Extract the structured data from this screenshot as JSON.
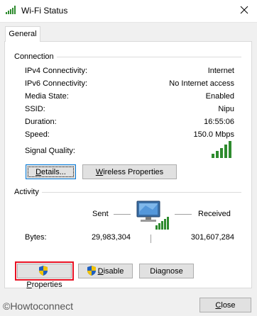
{
  "window": {
    "title": "Wi-Fi Status",
    "icon": "wifi-signal-icon",
    "close_icon": "close-icon"
  },
  "tab": {
    "label": "General"
  },
  "connection": {
    "group_label": "Connection",
    "rows": [
      {
        "label": "IPv4 Connectivity:",
        "value": "Internet"
      },
      {
        "label": "IPv6 Connectivity:",
        "value": "No Internet access"
      },
      {
        "label": "Media State:",
        "value": "Enabled"
      },
      {
        "label": "SSID:",
        "value": "Nipu"
      },
      {
        "label": "Duration:",
        "value": "16:55:06"
      },
      {
        "label": "Speed:",
        "value": "150.0 Mbps"
      }
    ],
    "signal_quality_label": "Signal Quality:",
    "signal_icon": "signal-bars-icon",
    "details_button": {
      "prefix": "",
      "underlined": "D",
      "suffix": "etails..."
    },
    "wireless_button": {
      "prefix": "",
      "underlined": "W",
      "suffix": "ireless Properties"
    }
  },
  "activity": {
    "group_label": "Activity",
    "sent_label": "Sent",
    "received_label": "Received",
    "bytes_label": "Bytes:",
    "bytes_sent": "29,983,304",
    "bytes_received": "301,607,284",
    "icon": "network-computer-icon"
  },
  "buttons": {
    "properties": {
      "prefix": "",
      "underlined": "P",
      "suffix": "roperties",
      "icon": "uac-shield-icon"
    },
    "disable": {
      "prefix": "",
      "underlined": "D",
      "suffix": "isable",
      "icon": "uac-shield-icon"
    },
    "diagnose": {
      "prefix": "Diagnose",
      "underlined": "",
      "suffix": ""
    },
    "close": {
      "prefix": "",
      "underlined": "C",
      "suffix": "lose"
    }
  },
  "watermark": "©Howtoconnect",
  "colors": {
    "signal_green": "#2e8b2e",
    "highlight_red": "#e81123",
    "focus_blue": "#0078d7"
  }
}
